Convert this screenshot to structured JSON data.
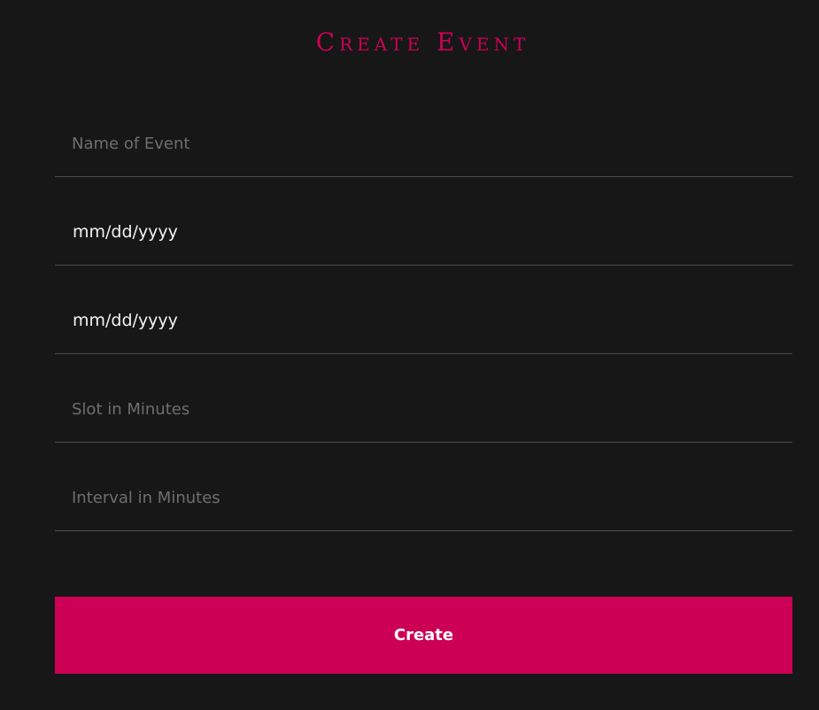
{
  "title": "Create Event",
  "form": {
    "event_name": {
      "value": "",
      "placeholder": "Name of Event"
    },
    "start_date": {
      "value": "mm/dd/yyyy"
    },
    "end_date": {
      "value": "mm/dd/yyyy"
    },
    "slot_minutes": {
      "value": "",
      "placeholder": "Slot in Minutes"
    },
    "interval_minutes": {
      "value": "",
      "placeholder": "Interval in Minutes"
    },
    "submit_label": "Create"
  },
  "colors": {
    "accent": "#cc0055",
    "background": "#171717",
    "divider": "#4d4d4d",
    "placeholder": "#6e6e6e"
  }
}
